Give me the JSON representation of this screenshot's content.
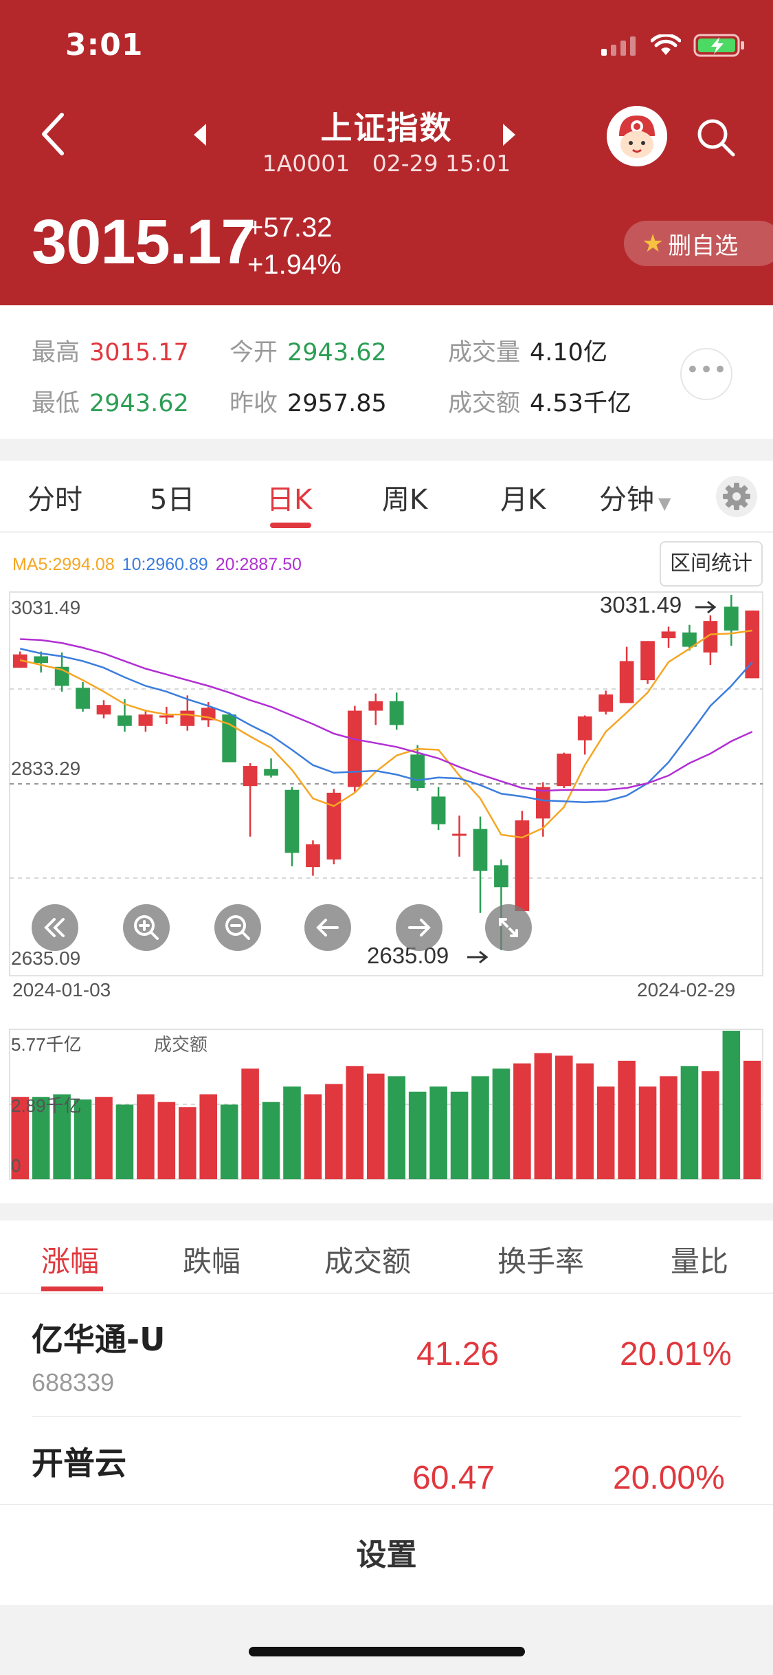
{
  "status_bar": {
    "time": "3:01"
  },
  "header": {
    "stock_name": "上证指数",
    "code": "1A0001",
    "datetime": "02-29 15:01",
    "price": "3015.17",
    "change": "+57.32",
    "change_pct": "+1.94%",
    "fav_button": "删自选"
  },
  "quote": {
    "high_label": "最高",
    "high": "3015.17",
    "open_label": "今开",
    "open": "2943.62",
    "volume_label": "成交量",
    "volume": "4.10亿",
    "low_label": "最低",
    "low": "2943.62",
    "prev_close_label": "昨收",
    "prev_close": "2957.85",
    "amount_label": "成交额",
    "amount": "4.53千亿"
  },
  "tabs": [
    "分时",
    "5日",
    "日K",
    "周K",
    "月K",
    "分钟"
  ],
  "active_tab": "日K",
  "chart": {
    "ma5_label": "MA5:2994.08",
    "ma10_label": "10:2960.89",
    "ma20_label": "20:2887.50",
    "interval_button": "区间统计",
    "y_top": "3031.49",
    "y_mid": "2833.29",
    "y_bottom": "2635.09",
    "max_marker": "3031.49",
    "min_marker": "2635.09",
    "date_start": "2024-01-03",
    "date_end": "2024-02-29",
    "vol_top": "5.77千亿",
    "vol_mid": "2.89千亿",
    "vol_zero": "0",
    "vol_label": "成交额"
  },
  "chart_data": {
    "type": "candlestick",
    "ylim": [
      2635.09,
      3031.49
    ],
    "up_color": "#e0383e",
    "down_color": "#2c9e54",
    "ma_colors": {
      "ma5": "#f5a623",
      "ma10": "#3b7ddd",
      "ma20": "#b12fd4"
    },
    "candles": [
      {
        "o": 2955,
        "c": 2969,
        "h": 2972,
        "l": 2955
      },
      {
        "o": 2967,
        "c": 2960,
        "h": 2972,
        "l": 2950
      },
      {
        "o": 2956,
        "c": 2936,
        "h": 2971,
        "l": 2930
      },
      {
        "o": 2934,
        "c": 2912,
        "h": 2940,
        "l": 2909
      },
      {
        "o": 2906,
        "c": 2916,
        "h": 2921,
        "l": 2902
      },
      {
        "o": 2905,
        "c": 2894,
        "h": 2922,
        "l": 2888
      },
      {
        "o": 2894,
        "c": 2906,
        "h": 2911,
        "l": 2888
      },
      {
        "o": 2903,
        "c": 2905,
        "h": 2914,
        "l": 2896
      },
      {
        "o": 2894,
        "c": 2910,
        "h": 2926,
        "l": 2889
      },
      {
        "o": 2900,
        "c": 2913,
        "h": 2919,
        "l": 2893
      },
      {
        "o": 2906,
        "c": 2856,
        "h": 2908,
        "l": 2856
      },
      {
        "o": 2831,
        "c": 2852,
        "h": 2855,
        "l": 2778
      },
      {
        "o": 2849,
        "c": 2842,
        "h": 2860,
        "l": 2840
      },
      {
        "o": 2827,
        "c": 2761,
        "h": 2830,
        "l": 2747
      },
      {
        "o": 2746,
        "c": 2770,
        "h": 2774,
        "l": 2737
      },
      {
        "o": 2754,
        "c": 2824,
        "h": 2828,
        "l": 2749
      },
      {
        "o": 2830,
        "c": 2910,
        "h": 2915,
        "l": 2825
      },
      {
        "o": 2910,
        "c": 2920,
        "h": 2928,
        "l": 2895
      },
      {
        "o": 2920,
        "c": 2895,
        "h": 2929,
        "l": 2890
      },
      {
        "o": 2864,
        "c": 2829,
        "h": 2874,
        "l": 2826
      },
      {
        "o": 2820,
        "c": 2791,
        "h": 2830,
        "l": 2785
      },
      {
        "o": 2780,
        "c": 2781,
        "h": 2800,
        "l": 2757
      },
      {
        "o": 2786,
        "c": 2742,
        "h": 2799,
        "l": 2698
      },
      {
        "o": 2748,
        "c": 2725,
        "h": 2754,
        "l": 2659
      },
      {
        "o": 2700,
        "c": 2795,
        "h": 2805,
        "l": 2700
      },
      {
        "o": 2797,
        "c": 2830,
        "h": 2835,
        "l": 2778
      },
      {
        "o": 2831,
        "c": 2865,
        "h": 2866,
        "l": 2829
      },
      {
        "o": 2879,
        "c": 2904,
        "h": 2905,
        "l": 2864
      },
      {
        "o": 2909,
        "c": 2927,
        "h": 2931,
        "l": 2906
      },
      {
        "o": 2918,
        "c": 2962,
        "h": 2977,
        "l": 2918
      },
      {
        "o": 2942,
        "c": 2983,
        "h": 2983,
        "l": 2938
      },
      {
        "o": 2986,
        "c": 2993,
        "h": 2998,
        "l": 2976
      },
      {
        "o": 2992,
        "c": 2977,
        "h": 3000,
        "l": 2973
      },
      {
        "o": 2971,
        "c": 3004,
        "h": 3010,
        "l": 2958
      },
      {
        "o": 3019,
        "c": 2994,
        "h": 3031.49,
        "l": 2978
      },
      {
        "o": 2944,
        "c": 3015,
        "h": 3015,
        "l": 2944
      }
    ],
    "ma5": [
      2963,
      2958,
      2953,
      2942,
      2930,
      2917,
      2910,
      2906,
      2906,
      2903,
      2896,
      2883,
      2871,
      2848,
      2818,
      2810,
      2824,
      2846,
      2863,
      2870,
      2869,
      2842,
      2818,
      2780,
      2777,
      2787,
      2809,
      2853,
      2888,
      2908,
      2929,
      2961,
      2975,
      2990,
      2991,
      2994
    ],
    "ma10": [
      2975,
      2970,
      2967,
      2962,
      2955,
      2945,
      2936,
      2930,
      2922,
      2915,
      2907,
      2895,
      2884,
      2869,
      2853,
      2845,
      2846,
      2847,
      2843,
      2837,
      2840,
      2839,
      2832,
      2823,
      2820,
      2816,
      2815,
      2814,
      2815,
      2821,
      2834,
      2856,
      2885,
      2915,
      2936,
      2961
    ],
    "ma20": [
      2985,
      2984,
      2981,
      2976,
      2970,
      2962,
      2954,
      2948,
      2942,
      2936,
      2929,
      2921,
      2914,
      2905,
      2896,
      2886,
      2880,
      2876,
      2872,
      2866,
      2860,
      2851,
      2843,
      2836,
      2829,
      2826,
      2827,
      2827,
      2827,
      2829,
      2834,
      2842,
      2855,
      2865,
      2878,
      2888
    ],
    "volume": {
      "ylim": [
        0,
        5.77
      ],
      "unit": "千亿",
      "values": [
        3.2,
        3.2,
        3.3,
        3.1,
        3.2,
        2.9,
        3.3,
        3.0,
        2.8,
        3.3,
        2.9,
        4.3,
        3.0,
        3.6,
        3.3,
        3.7,
        4.4,
        4.1,
        4.0,
        3.4,
        3.6,
        3.4,
        4.0,
        4.3,
        4.5,
        4.9,
        4.8,
        4.5,
        3.6,
        4.6,
        3.6,
        4.0,
        4.4,
        4.2,
        5.77,
        4.6
      ],
      "colors": [
        "r",
        "g",
        "g",
        "g",
        "r",
        "g",
        "r",
        "r",
        "r",
        "r",
        "g",
        "r",
        "g",
        "g",
        "r",
        "r",
        "r",
        "r",
        "g",
        "g",
        "g",
        "g",
        "g",
        "g",
        "r",
        "r",
        "r",
        "r",
        "r",
        "r",
        "r",
        "r",
        "g",
        "r",
        "g",
        "r"
      ]
    }
  },
  "bottom_tabs": [
    "涨幅",
    "跌幅",
    "成交额",
    "换手率",
    "量比"
  ],
  "list": [
    {
      "name": "亿华通-U",
      "code": "688339",
      "price": "41.26",
      "pct": "20.01%"
    },
    {
      "name": "开普云",
      "code": "",
      "price": "60.47",
      "pct": "20.00%"
    }
  ],
  "settings_label": "设置"
}
